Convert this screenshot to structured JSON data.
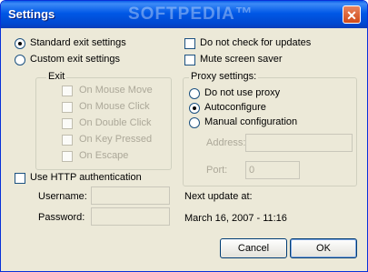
{
  "window": {
    "title": "Settings",
    "watermark": "SOFTPEDIA™",
    "close_glyph": "✕"
  },
  "exit": {
    "standard_label": "Standard exit settings",
    "custom_label": "Custom exit settings",
    "selected": "standard",
    "group_label": "Exit",
    "options": [
      {
        "label": "On Mouse Move",
        "checked": false,
        "enabled": false
      },
      {
        "label": "On Mouse Click",
        "checked": false,
        "enabled": false
      },
      {
        "label": "On Double Click",
        "checked": false,
        "enabled": false
      },
      {
        "label": "On Key Pressed",
        "checked": false,
        "enabled": false
      },
      {
        "label": "On Escape",
        "checked": false,
        "enabled": false
      }
    ]
  },
  "options": {
    "no_updates_label": "Do not check for updates",
    "no_updates_checked": false,
    "mute_label": "Mute screen saver",
    "mute_checked": false
  },
  "proxy": {
    "group_label": "Proxy settings:",
    "none_label": "Do not use proxy",
    "auto_label": "Autoconfigure",
    "manual_label": "Manual configuration",
    "selected": "auto",
    "address_label": "Address:",
    "address_value": "",
    "port_label": "Port:",
    "port_value": "0"
  },
  "auth": {
    "label": "Use HTTP authentication",
    "checked": false,
    "username_label": "Username:",
    "username_value": "",
    "password_label": "Password:",
    "password_value": ""
  },
  "update": {
    "label": "Next update at:",
    "value": "March 16, 2007 - 11:16"
  },
  "buttons": {
    "cancel": "Cancel",
    "ok": "OK"
  }
}
